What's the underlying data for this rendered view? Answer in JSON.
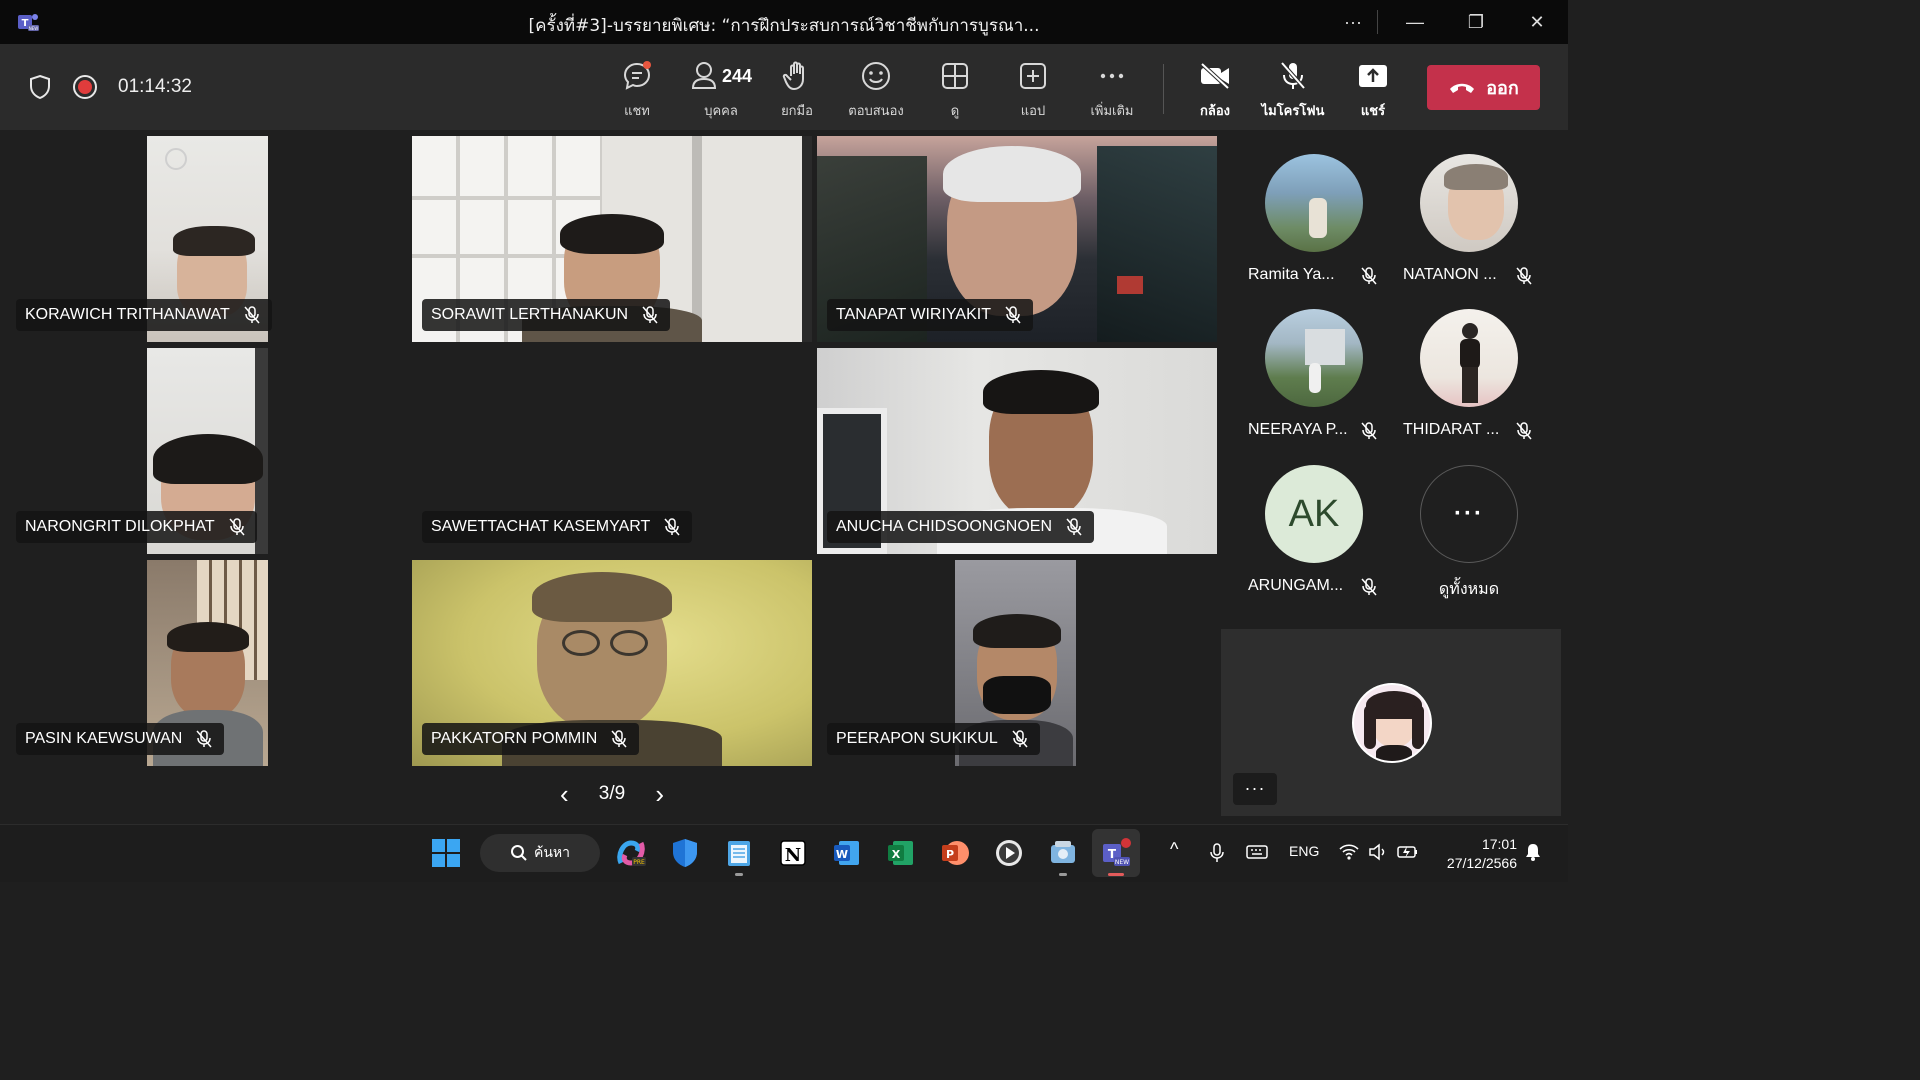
{
  "window": {
    "title": "[ครั้งที่#3]-บรรยายพิเศษ: “การฝึกประสบการณ์วิชาชีพกับการบูรณา...",
    "more": "···",
    "minimize": "—",
    "restore": "❐",
    "close": "✕"
  },
  "meeting": {
    "timer": "01:14:32",
    "participant_count": "244",
    "tools": {
      "chat": "แชท",
      "people": "บุคคล",
      "raise": "ยกมือ",
      "react": "ตอบสนอง",
      "view": "ดู",
      "apps": "แอป",
      "more": "เพิ่มเติม",
      "camera": "กล้อง",
      "mic": "ไมโครโฟน",
      "share": "แชร์"
    },
    "leave_label": "ออก",
    "colors": {
      "leave": "#c4314b",
      "notify": "#e8563f",
      "record": "#e03c3c"
    }
  },
  "tiles": [
    {
      "name": "KORAWICH TRITHANAWAT"
    },
    {
      "name": "SORAWIT LERTHANAKUN"
    },
    {
      "name": "TANAPAT WIRIYAKIT"
    },
    {
      "name": "NARONGRIT DILOKPHAT"
    },
    {
      "name": "SAWETTACHAT KASEMYART"
    },
    {
      "name": "ANUCHA CHIDSOONGNOEN"
    },
    {
      "name": "PASIN KAEWSUWAN"
    },
    {
      "name": "PAKKATORN POMMIN"
    },
    {
      "name": "PEERAPON SUKIKUL"
    }
  ],
  "pager": {
    "label": "3/9",
    "prev": "‹",
    "next": "›"
  },
  "roster": [
    {
      "name": "Ramita Ya..."
    },
    {
      "name": "NATANON ..."
    },
    {
      "name": "NEERAYA P..."
    },
    {
      "name": "THIDARAT ..."
    },
    {
      "name": "ARUNGAM...",
      "initials": "AK"
    },
    {
      "name": "ดูทั้งหมด",
      "dots": "···"
    }
  ],
  "self_more": "···",
  "taskbar": {
    "search_label": "ค้นหา",
    "lang": "ENG",
    "time": "17:01",
    "date": "27/12/2566",
    "chevron": "^"
  }
}
